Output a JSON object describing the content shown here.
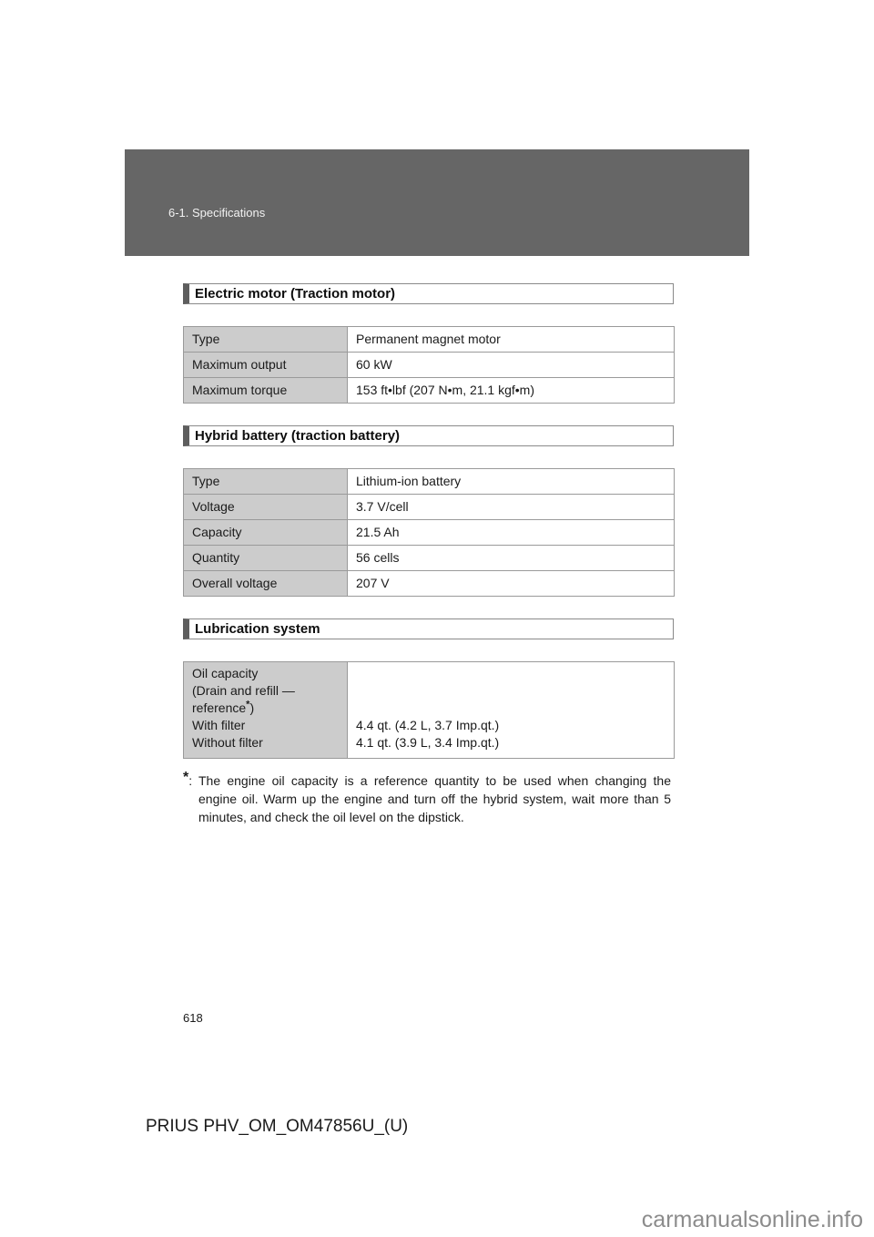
{
  "header": {
    "section": "6-1. Specifications"
  },
  "sections": [
    {
      "title": "Electric motor (Traction motor)",
      "rows": [
        {
          "label": "Type",
          "value": "Permanent magnet motor"
        },
        {
          "label": "Maximum output",
          "value": "60 kW"
        },
        {
          "label": "Maximum torque",
          "value": "153 ft•lbf (207 N•m, 21.1 kgf•m)"
        }
      ]
    },
    {
      "title": "Hybrid battery (traction battery)",
      "rows": [
        {
          "label": "Type",
          "value": "Lithium-ion battery"
        },
        {
          "label": "Voltage",
          "value": "3.7 V/cell"
        },
        {
          "label": "Capacity",
          "value": "21.5 Ah"
        },
        {
          "label": "Quantity",
          "value": "56 cells"
        },
        {
          "label": "Overall voltage",
          "value": "207 V"
        }
      ]
    },
    {
      "title": "Lubrication system",
      "oil": {
        "label_line1": "Oil capacity",
        "label_line2": "(Drain and refill —",
        "label_line3": "reference",
        "label_line3_mark": "*",
        "label_line3_end": ")",
        "with_filter_label": "With filter",
        "without_filter_label": "Without filter",
        "with_filter_value": "4.4 qt. (4.2 L, 3.7 Imp.qt.)",
        "without_filter_value": "4.1 qt. (3.9 L, 3.4 Imp.qt.)"
      }
    }
  ],
  "footnote": {
    "mark": "*",
    "separator": ":",
    "text": "The engine oil capacity is a reference quantity to be used when changing the engine oil. Warm up the engine and turn off the hybrid system, wait more than 5 minutes, and check the oil level on the dipstick."
  },
  "footer": {
    "page_number": "618",
    "document_id": "PRIUS PHV_OM_OM47856U_(U)",
    "watermark": "carmanualsonline.info"
  }
}
